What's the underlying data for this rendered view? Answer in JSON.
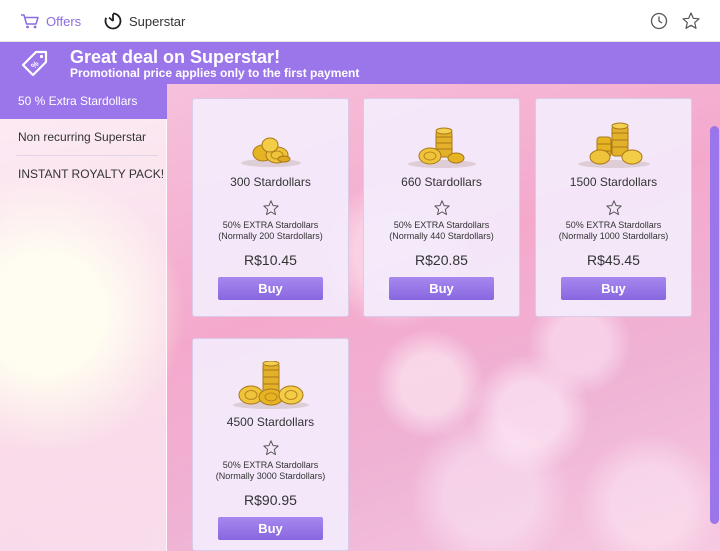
{
  "nav": {
    "offers_label": "Offers",
    "superstar_label": "Superstar",
    "offers_icon": "cart-icon",
    "superstar_icon": "superstar-timer-icon",
    "history_icon": "clock-icon",
    "favorite_icon": "star-icon"
  },
  "banner": {
    "title": "Great deal on Superstar!",
    "subtitle": "Promotional price applies only to the first payment",
    "icon": "discount-tag-icon"
  },
  "sidebar": {
    "items": [
      {
        "label": "50 % Extra Stardollars",
        "active": true
      },
      {
        "label": "Non recurring Superstar",
        "active": false
      },
      {
        "label": "INSTANT ROYALTY PACK!",
        "active": false
      }
    ]
  },
  "offers": [
    {
      "amount": "300 Stardollars",
      "extra_line1": "50% EXTRA Stardollars",
      "extra_line2": "(Normally 200 Stardollars)",
      "price": "R$10.45",
      "buy_label": "Buy"
    },
    {
      "amount": "660 Stardollars",
      "extra_line1": "50% EXTRA Stardollars",
      "extra_line2": "(Normally 440 Stardollars)",
      "price": "R$20.85",
      "buy_label": "Buy"
    },
    {
      "amount": "1500 Stardollars",
      "extra_line1": "50% EXTRA Stardollars",
      "extra_line2": "(Normally 1000 Stardollars)",
      "price": "R$45.45",
      "buy_label": "Buy"
    },
    {
      "amount": "4500 Stardollars",
      "extra_line1": "50% EXTRA Stardollars",
      "extra_line2": "(Normally 3000 Stardollars)",
      "price": "R$90.95",
      "buy_label": "Buy"
    }
  ],
  "colors": {
    "accent": "#9b76ea",
    "button": "#8d6ce2",
    "card_bg": "#f3ecfc",
    "coin_gold": "#e6b422"
  }
}
